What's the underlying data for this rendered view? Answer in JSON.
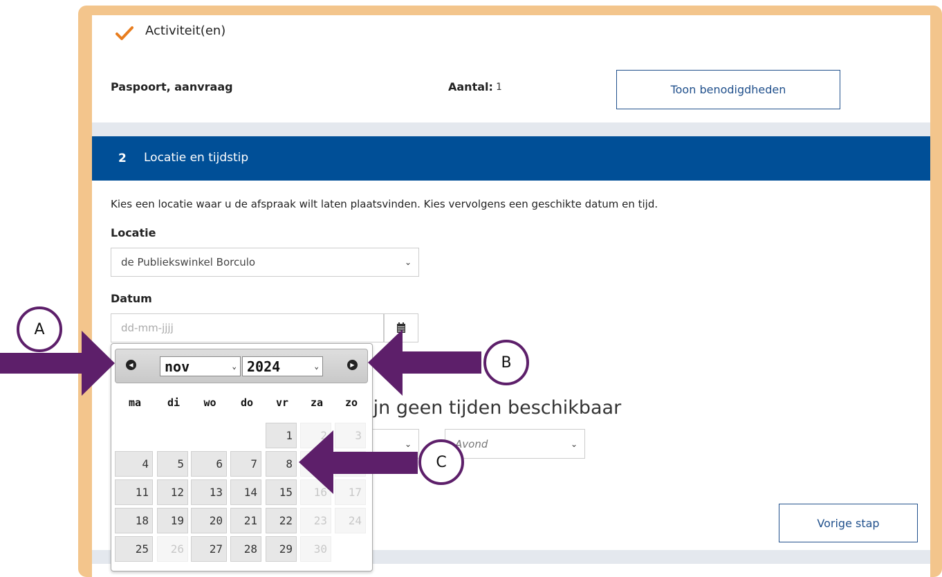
{
  "activities": {
    "title": "Activiteit(en)",
    "item_name": "Paspoort, aanvraag",
    "count_label": "Aantal:",
    "count_value": "1",
    "show_requirements_label": "Toon benodigdheden"
  },
  "section2": {
    "number": "2",
    "title": "Locatie en tijdstip",
    "intro": "Kies een locatie waar u de afspraak wilt laten plaatsvinden. Kies vervolgens een geschikte datum en tijd.",
    "location_label": "Locatie",
    "location_value": "de Publiekswinkel Borculo",
    "date_label": "Datum",
    "date_placeholder": "dd-mm-jjjj",
    "no_times_text": "zijn geen tijden beschikbaar",
    "evening_value": "Avond",
    "prev_step_label": "Vorige stap"
  },
  "datepicker": {
    "month": "nov",
    "year": "2024",
    "weekdays": [
      "ma",
      "di",
      "wo",
      "do",
      "vr",
      "za",
      "zo"
    ],
    "weeks": [
      [
        null,
        null,
        null,
        null,
        {
          "d": "1",
          "enabled": true
        },
        {
          "d": "2",
          "enabled": false
        },
        {
          "d": "3",
          "enabled": false
        }
      ],
      [
        {
          "d": "4",
          "enabled": true
        },
        {
          "d": "5",
          "enabled": true
        },
        {
          "d": "6",
          "enabled": true
        },
        {
          "d": "7",
          "enabled": true
        },
        {
          "d": "8",
          "enabled": true
        },
        {
          "d": "9",
          "enabled": false
        },
        {
          "d": "10",
          "enabled": false
        }
      ],
      [
        {
          "d": "11",
          "enabled": true
        },
        {
          "d": "12",
          "enabled": true
        },
        {
          "d": "13",
          "enabled": true
        },
        {
          "d": "14",
          "enabled": true
        },
        {
          "d": "15",
          "enabled": true
        },
        {
          "d": "16",
          "enabled": false
        },
        {
          "d": "17",
          "enabled": false
        }
      ],
      [
        {
          "d": "18",
          "enabled": true
        },
        {
          "d": "19",
          "enabled": true
        },
        {
          "d": "20",
          "enabled": true
        },
        {
          "d": "21",
          "enabled": true
        },
        {
          "d": "22",
          "enabled": true
        },
        {
          "d": "23",
          "enabled": false
        },
        {
          "d": "24",
          "enabled": false
        }
      ],
      [
        {
          "d": "25",
          "enabled": true
        },
        {
          "d": "26",
          "enabled": false
        },
        {
          "d": "27",
          "enabled": true
        },
        {
          "d": "28",
          "enabled": true
        },
        {
          "d": "29",
          "enabled": true
        },
        {
          "d": "30",
          "enabled": false
        },
        null
      ]
    ]
  },
  "annotations": {
    "a": "A",
    "b": "B",
    "c": "C",
    "color": "#5d1f6a"
  },
  "colors": {
    "brand_blue": "#004f97",
    "frame_orange": "#f3c58c",
    "check_orange": "#e87d1e"
  }
}
